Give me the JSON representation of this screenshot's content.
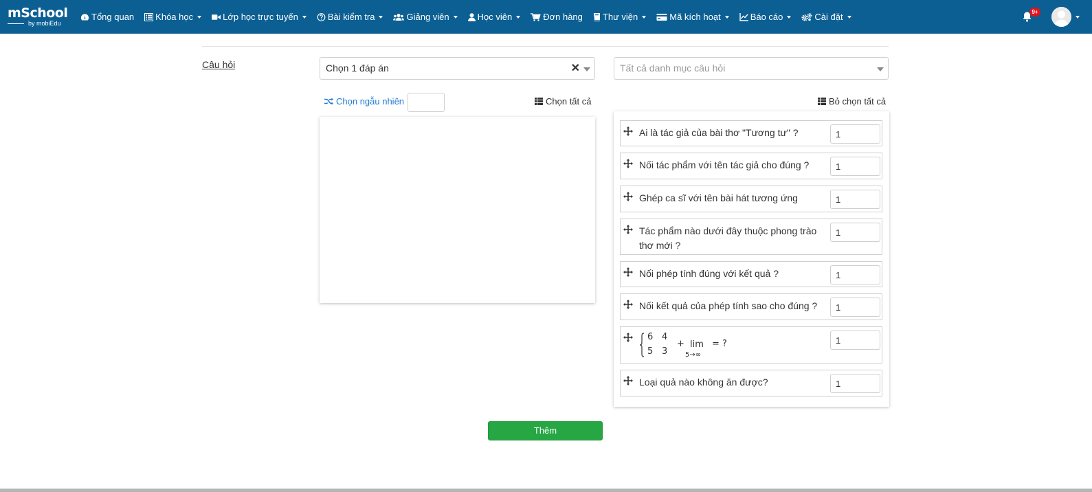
{
  "navbar": {
    "brand": "mSchool",
    "brand_sub": "by mobiEdu",
    "items": [
      {
        "label": "Tổng quan",
        "icon": "dashboard-icon",
        "has_caret": false
      },
      {
        "label": "Khóa học",
        "icon": "list-icon",
        "has_caret": true
      },
      {
        "label": "Lớp học trực tuyến",
        "icon": "video-icon",
        "has_caret": true
      },
      {
        "label": "Bài kiểm tra",
        "icon": "question-circle-icon",
        "has_caret": true
      },
      {
        "label": "Giảng viên",
        "icon": "users-icon",
        "has_caret": true
      },
      {
        "label": "Học viên",
        "icon": "user-icon",
        "has_caret": true
      },
      {
        "label": "Đơn hàng",
        "icon": "cart-icon",
        "has_caret": false
      },
      {
        "label": "Thư viện",
        "icon": "book-icon",
        "has_caret": true
      },
      {
        "label": "Mã kích hoạt",
        "icon": "card-icon",
        "has_caret": true
      },
      {
        "label": "Báo cáo",
        "icon": "chart-icon",
        "has_caret": true
      },
      {
        "label": "Cài đặt",
        "icon": "cogs-icon",
        "has_caret": true
      }
    ],
    "notification_badge": "9+"
  },
  "form": {
    "section_label": "Câu hỏi",
    "answer_type_select": "Chọn 1 đáp án",
    "category_select_placeholder": "Tất cả danh mục câu hỏi",
    "random_label": "Chọn ngẫu nhiên",
    "random_value": "",
    "select_all_label": "Chọn tất cả",
    "deselect_all_label": "Bỏ chọn tất cả",
    "submit_label": "Thêm"
  },
  "selected_questions": [
    {
      "text": "Ai là tác giả của bài thơ \"Tương tư\" ?",
      "score": "1"
    },
    {
      "text": "Nối tác phẩm với tên tác giả cho đúng ?",
      "score": "1"
    },
    {
      "text": "Ghép ca sĩ với tên bài hát tương ứng",
      "score": "1"
    },
    {
      "text": "Tác phẩm nào dưới đây thuộc phong trào thơ mới ?",
      "score": "1"
    },
    {
      "text": "Nối phép tính đúng với kết quả ?",
      "score": "1"
    },
    {
      "text": "Nối kết quả của phép tính sao cho đúng ?",
      "score": "1"
    },
    {
      "text": "",
      "score": "1",
      "math": {
        "r1c1": "6",
        "r1c2": "4",
        "r2c1": "5",
        "r2c2": "3",
        "plus": "+",
        "lim": "lim",
        "lim_sub": "5→∞",
        "eq": "= ?"
      }
    },
    {
      "text": "Loại quả nào không ăn được?",
      "score": "1"
    }
  ],
  "colors": {
    "navbar_bg": "#0b5f93",
    "link": "#1f7ad6",
    "submit_bg": "#27a644",
    "badge": "#e1141e"
  }
}
